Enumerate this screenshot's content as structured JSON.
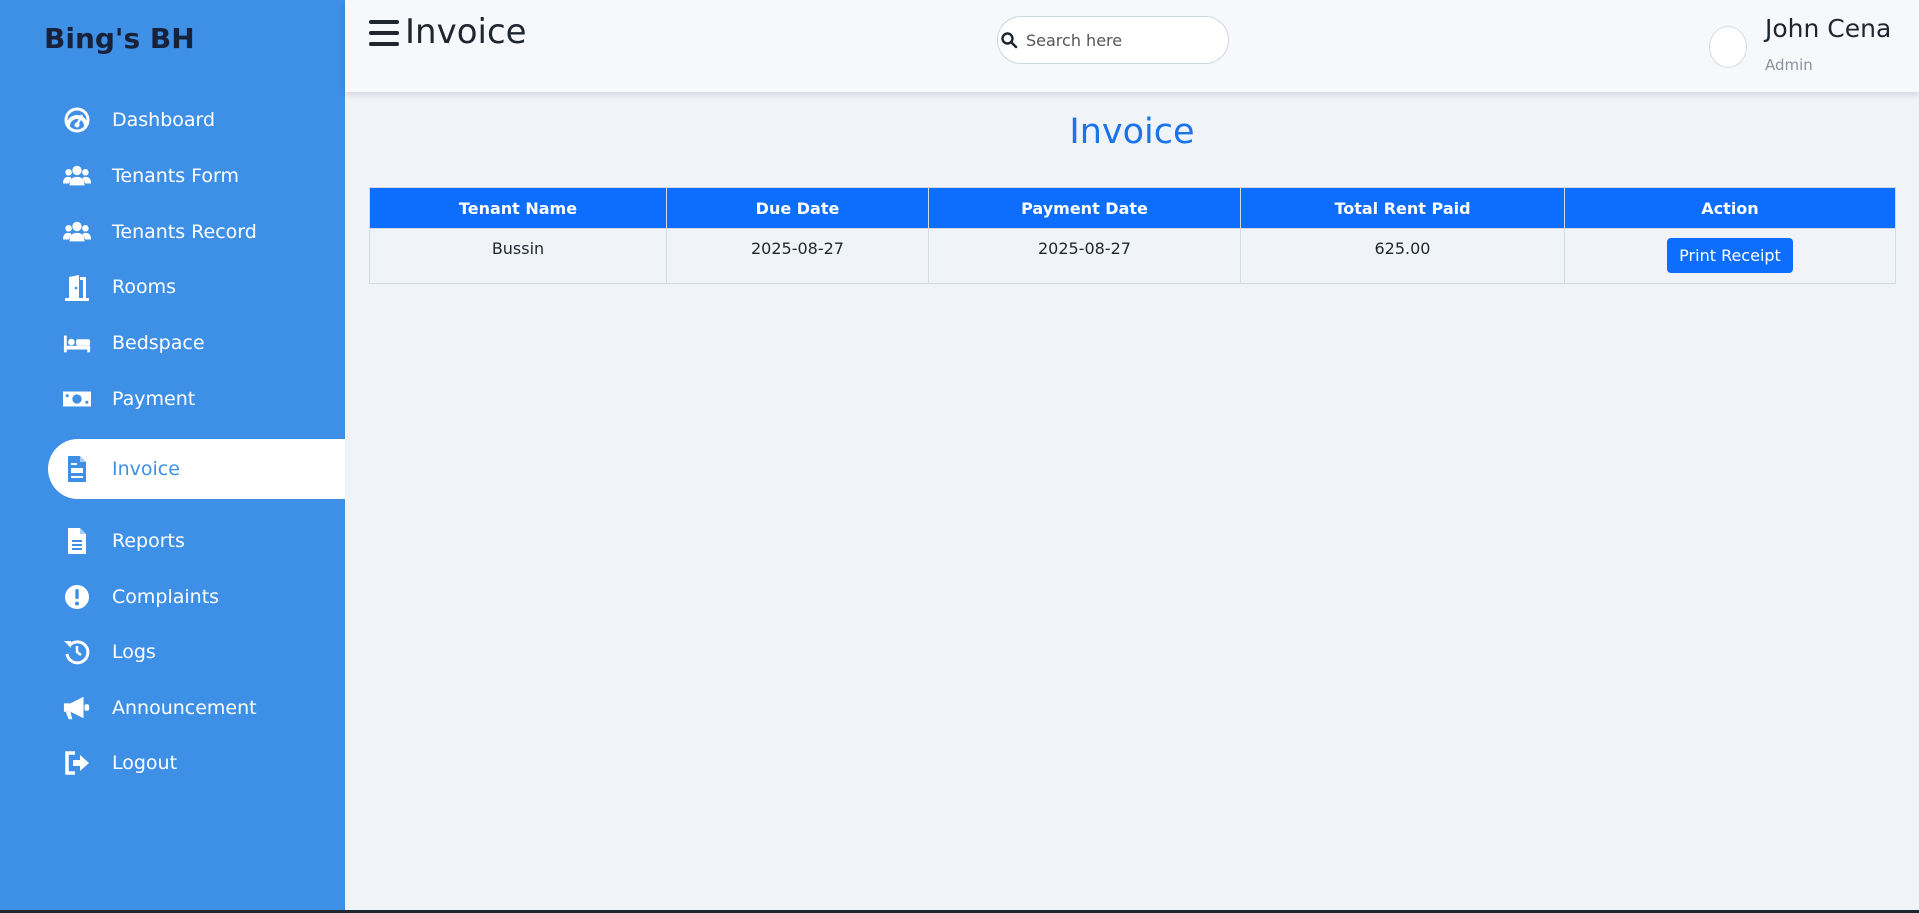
{
  "sidebar": {
    "brand": "Bing's BH",
    "items": [
      {
        "label": "Dashboard",
        "icon": "dashboard-icon",
        "active": false
      },
      {
        "label": "Tenants Form",
        "icon": "users-icon",
        "active": false
      },
      {
        "label": "Tenants Record",
        "icon": "users-icon",
        "active": false
      },
      {
        "label": "Rooms",
        "icon": "door-icon",
        "active": false
      },
      {
        "label": "Bedspace",
        "icon": "bed-icon",
        "active": false
      },
      {
        "label": "Payment",
        "icon": "money-icon",
        "active": false
      },
      {
        "label": "Invoice",
        "icon": "invoice-icon",
        "active": true
      },
      {
        "label": "Reports",
        "icon": "document-icon",
        "active": false
      },
      {
        "label": "Complaints",
        "icon": "exclamation-icon",
        "active": false
      },
      {
        "label": "Logs",
        "icon": "history-icon",
        "active": false
      },
      {
        "label": "Announcement",
        "icon": "megaphone-icon",
        "active": false
      },
      {
        "label": "Logout",
        "icon": "logout-icon",
        "active": false
      }
    ]
  },
  "header": {
    "title": "Invoice",
    "search_placeholder": "Search here",
    "user_name": "John Cena",
    "user_role": "Admin"
  },
  "main": {
    "heading": "Invoice",
    "table": {
      "columns": [
        "Tenant Name",
        "Due Date",
        "Payment Date",
        "Total Rent Paid",
        "Action"
      ],
      "rows": [
        {
          "tenant_name": "Bussin",
          "due_date": "2025-08-27",
          "payment_date": "2025-08-27",
          "total_rent_paid": "625.00",
          "action_label": "Print Receipt"
        }
      ]
    }
  },
  "colors": {
    "sidebar": "#3e90e6",
    "accent": "#0d6efd",
    "heading": "#1a73e8"
  }
}
